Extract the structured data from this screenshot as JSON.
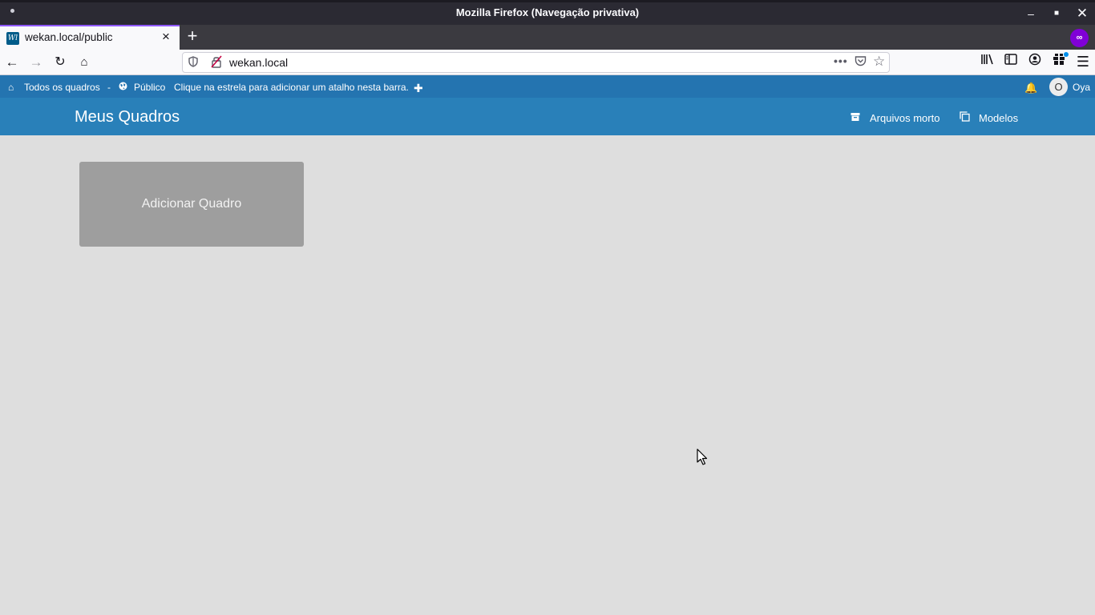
{
  "window": {
    "title": "Mozilla Firefox (Navegação privativa)"
  },
  "tab": {
    "title": "wekan.local/public",
    "favicon_text": "Wl"
  },
  "navbar": {
    "url": "wekan.local"
  },
  "wekan_topbar": {
    "all_boards": "Todos os quadros",
    "separator": "-",
    "public": "Público",
    "hint": "Clique na estrela para adicionar um atalho nesta barra.",
    "user_initial": "O",
    "user_name": "Oya"
  },
  "wekan_header": {
    "title": "Meus Quadros",
    "archive_label": "Arquivos morto",
    "templates_label": "Modelos"
  },
  "main": {
    "add_board_label": "Adicionar Quadro"
  },
  "colors": {
    "header_blue": "#2980b9",
    "topbar_blue": "#2474b0",
    "background": "#dedede",
    "add_board_tile": "#9e9e9e",
    "private_browsing_purple": "#8000d7"
  }
}
